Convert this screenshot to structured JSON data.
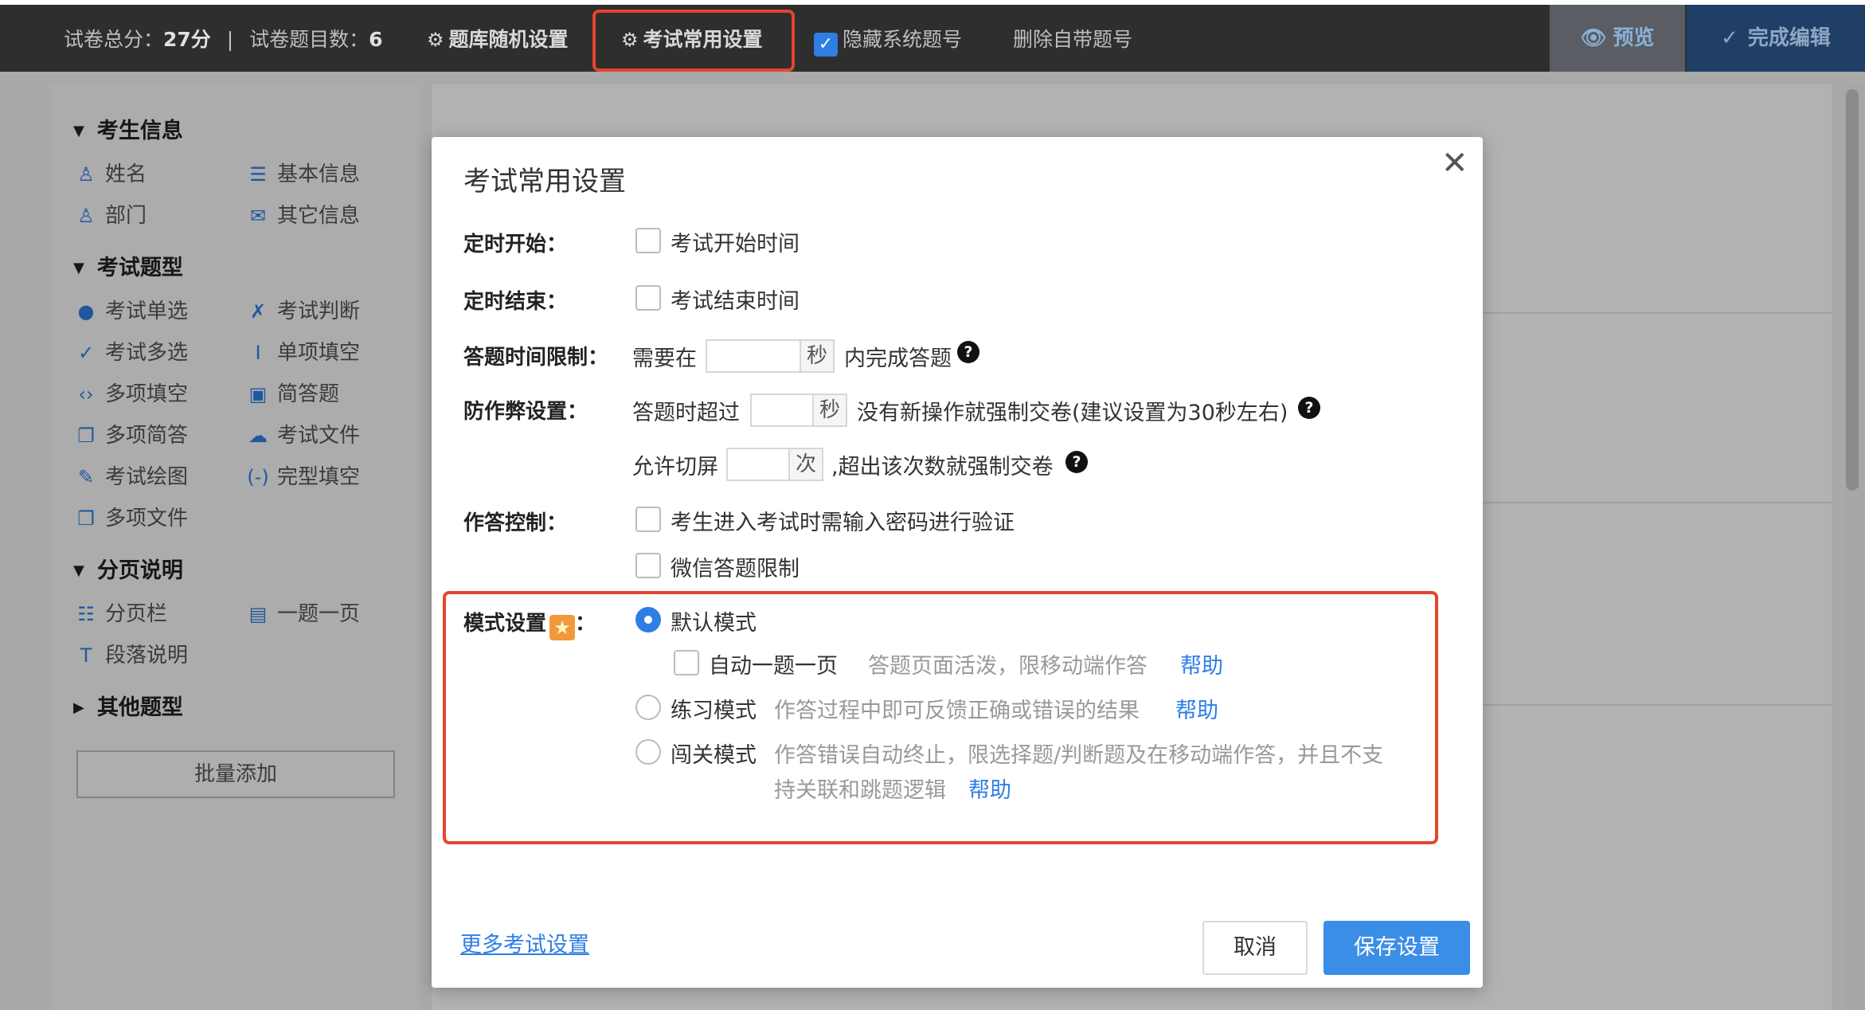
{
  "topbar": {
    "total_score_label": "试卷总分：",
    "total_score_value": "27分",
    "separator": "|",
    "question_count_label": "试卷题目数：",
    "question_count_value": "6",
    "random_settings": "题库随机设置",
    "common_settings": "考试常用设置",
    "hide_numbers": "隐藏系统题号",
    "delete_numbers": "删除自带题号",
    "preview": "预览",
    "finish": "完成编辑"
  },
  "sidebar": {
    "sections": [
      {
        "title": "考生信息",
        "items": [
          "姓名",
          "基本信息",
          "部门",
          "其它信息"
        ]
      },
      {
        "title": "考试题型",
        "items": [
          "考试单选",
          "考试判断",
          "考试多选",
          "单项填空",
          "多项填空",
          "简答题",
          "多项简答",
          "考试文件",
          "考试绘图",
          "完型填空",
          "多项文件"
        ]
      },
      {
        "title": "分页说明",
        "items": [
          "分页栏",
          "一题一页",
          "段落说明"
        ]
      },
      {
        "title": "其他题型",
        "items": []
      }
    ],
    "batch_add": "批量添加"
  },
  "modal": {
    "title": "考试常用设置",
    "timed_start_label": "定时开始：",
    "timed_start_option": "考试开始时间",
    "timed_end_label": "定时结束：",
    "timed_end_option": "考试结束时间",
    "time_limit_label": "答题时间限制：",
    "time_limit_prefix": "需要在",
    "time_limit_unit": "秒",
    "time_limit_suffix": "内完成答题",
    "anticheat_label": "防作弊设置：",
    "idle_prefix": "答题时超过",
    "idle_unit": "秒",
    "idle_suffix": "没有新操作就强制交卷(建议设置为30秒左右)",
    "switch_prefix": "允许切屏",
    "switch_unit": "次",
    "switch_suffix": ",超出该次数就强制交卷",
    "answer_control_label": "作答控制：",
    "password_option": "考生进入考试时需输入密码进行验证",
    "wechat_option": "微信答题限制",
    "mode_label": "模式设置",
    "mode_colon": "：",
    "default_mode": "默认模式",
    "auto_one_page": "自动一题一页",
    "auto_one_page_desc": "答题页面活泼，限移动端作答",
    "help": "帮助",
    "practice_mode": "练习模式",
    "practice_desc": "作答过程中即可反馈正确或错误的结果",
    "level_mode": "闯关模式",
    "level_desc_line1": "作答错误自动终止，限选择题/判断题及在移动端作答，并且不支",
    "level_desc_line2": "持关联和跳题逻辑",
    "more_settings": "更多考试设置",
    "cancel": "取消",
    "save": "保存设置"
  },
  "icons": {
    "gear": "gear-icon",
    "check": "check-icon",
    "eye": "eye-icon",
    "close": "close-icon",
    "question": "question-icon",
    "star": "star-icon"
  },
  "colors": {
    "accent": "#2e7ee4",
    "highlight_border": "#e4452e",
    "topbar_bg": "#2e2e2e"
  }
}
